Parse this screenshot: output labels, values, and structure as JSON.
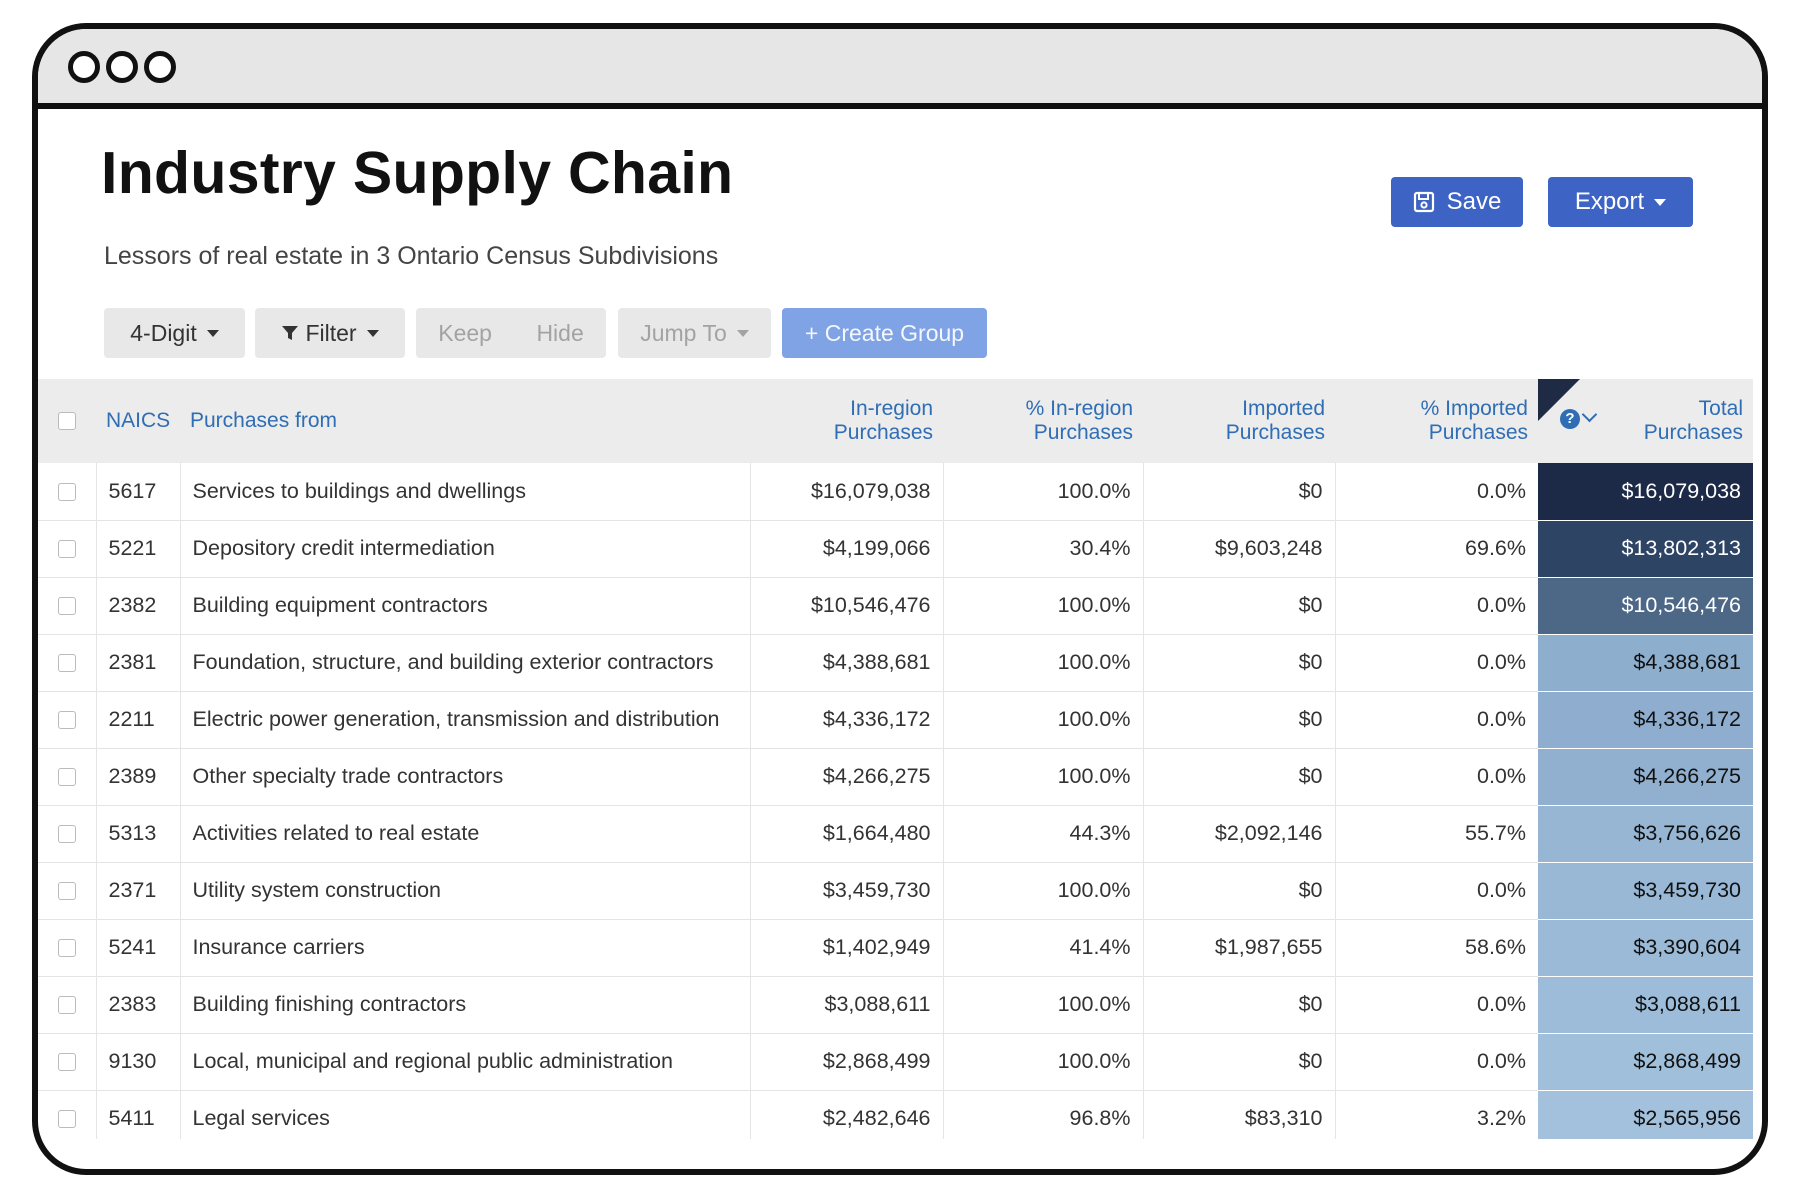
{
  "window": {
    "traffic_lights": [
      "dot",
      "dot",
      "dot"
    ]
  },
  "header": {
    "title": "Industry Supply Chain",
    "subtitle": "Lessors of real estate in 3 Ontario Census Subdivisions",
    "save_label": "Save",
    "export_label": "Export",
    "save_icon": "floppy-disk-icon",
    "accent_color": "#3d63c5"
  },
  "toolbar": {
    "digit_label": "4-Digit",
    "filter_label": "Filter",
    "keep_label": "Keep",
    "hide_label": "Hide",
    "jumpto_label": "Jump To",
    "create_group_label": "+ Create Group"
  },
  "table": {
    "headers": {
      "naics": "NAICS",
      "purchases_from": "Purchases from",
      "inregion_1": "In-region",
      "inregion_2": "Purchases",
      "pct_inregion_1": "% In-region",
      "pct_inregion_2": "Purchases",
      "imported_1": "Imported",
      "imported_2": "Purchases",
      "pct_imported_1": "% Imported",
      "pct_imported_2": "Purchases",
      "total_1": "Total",
      "total_2": "Purchases"
    },
    "rows": [
      {
        "naics": "5617",
        "name": "Services to buildings and dwellings",
        "inregion": "$16,079,038",
        "pct_inregion": "100.0%",
        "imported": "$0",
        "pct_imported": "0.0%",
        "total": "$16,079,038",
        "shade": "#1c2a47"
      },
      {
        "naics": "5221",
        "name": "Depository credit intermediation",
        "inregion": "$4,199,066",
        "pct_inregion": "30.4%",
        "imported": "$9,603,248",
        "pct_imported": "69.6%",
        "total": "$13,802,313",
        "shade": "#2e4465"
      },
      {
        "naics": "2382",
        "name": "Building equipment contractors",
        "inregion": "$10,546,476",
        "pct_inregion": "100.0%",
        "imported": "$0",
        "pct_imported": "0.0%",
        "total": "$10,546,476",
        "shade": "#4d6787"
      },
      {
        "naics": "2381",
        "name": "Foundation, structure, and building exterior contractors",
        "inregion": "$4,388,681",
        "pct_inregion": "100.0%",
        "imported": "$0",
        "pct_imported": "0.0%",
        "total": "$4,388,681",
        "shade": "#8eaece"
      },
      {
        "naics": "2211",
        "name": "Electric power generation, transmission and distribution",
        "inregion": "$4,336,172",
        "pct_inregion": "100.0%",
        "imported": "$0",
        "pct_imported": "0.0%",
        "total": "$4,336,172",
        "shade": "#8faecf"
      },
      {
        "naics": "2389",
        "name": "Other specialty trade contractors",
        "inregion": "$4,266,275",
        "pct_inregion": "100.0%",
        "imported": "$0",
        "pct_imported": "0.0%",
        "total": "$4,266,275",
        "shade": "#91b0d0"
      },
      {
        "naics": "5313",
        "name": "Activities related to real estate",
        "inregion": "$1,664,480",
        "pct_inregion": "44.3%",
        "imported": "$2,092,146",
        "pct_imported": "55.7%",
        "total": "$3,756,626",
        "shade": "#97b6d4"
      },
      {
        "naics": "2371",
        "name": "Utility system construction",
        "inregion": "$3,459,730",
        "pct_inregion": "100.0%",
        "imported": "$0",
        "pct_imported": "0.0%",
        "total": "$3,459,730",
        "shade": "#99b8d6"
      },
      {
        "naics": "5241",
        "name": "Insurance carriers",
        "inregion": "$1,402,949",
        "pct_inregion": "41.4%",
        "imported": "$1,987,655",
        "pct_imported": "58.6%",
        "total": "$3,390,604",
        "shade": "#9abad7"
      },
      {
        "naics": "2383",
        "name": "Building finishing contractors",
        "inregion": "$3,088,611",
        "pct_inregion": "100.0%",
        "imported": "$0",
        "pct_imported": "0.0%",
        "total": "$3,088,611",
        "shade": "#9dbcd9"
      },
      {
        "naics": "9130",
        "name": "Local, municipal and regional public administration",
        "inregion": "$2,868,499",
        "pct_inregion": "100.0%",
        "imported": "$0",
        "pct_imported": "0.0%",
        "total": "$2,868,499",
        "shade": "#a0bfda"
      },
      {
        "naics": "5411",
        "name": "Legal services",
        "inregion": "$2,482,646",
        "pct_inregion": "96.8%",
        "imported": "$83,310",
        "pct_imported": "3.2%",
        "total": "$2,565,956",
        "shade": "#a3c1dc"
      }
    ]
  }
}
